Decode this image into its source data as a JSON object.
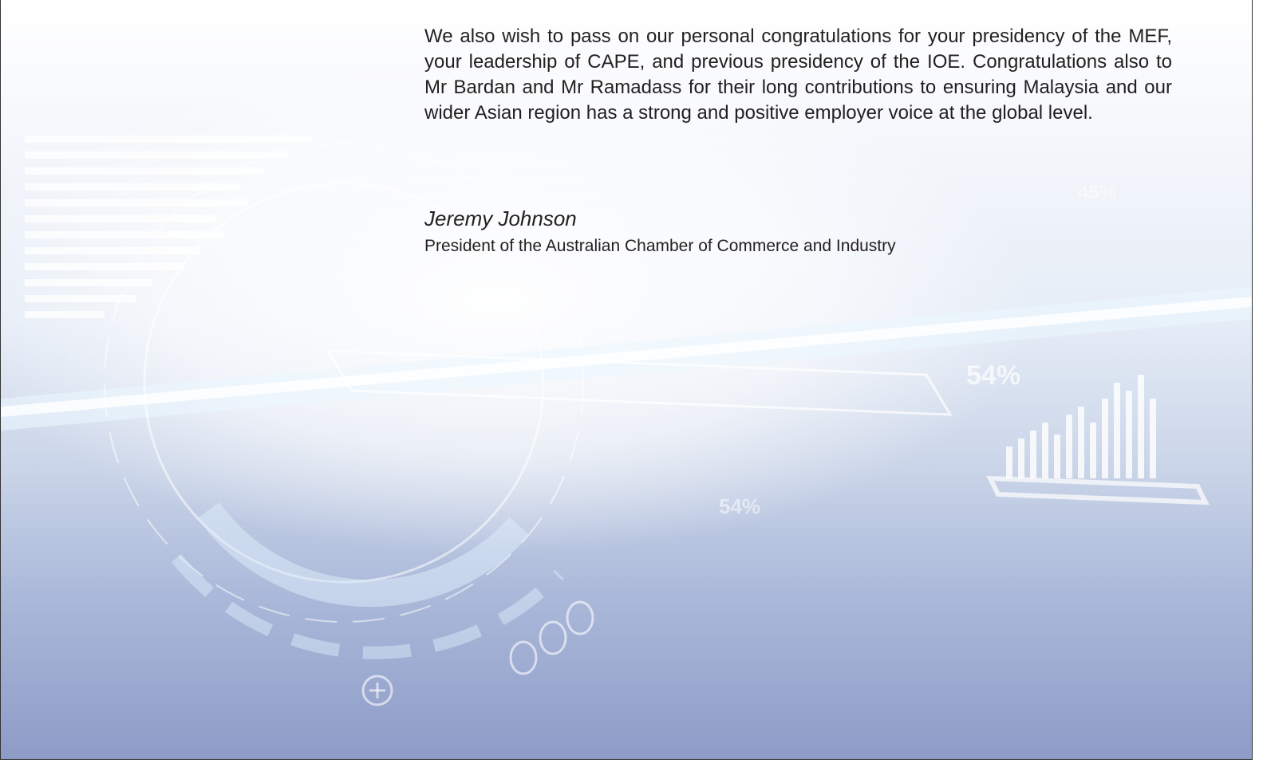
{
  "letter": {
    "paragraph": "We also wish to pass on our personal congratulations for your presidency of the MEF, your leadership of CAPE, and previous presidency of the IOE. Congratulations also to Mr Bardan and Mr Ramadass for their long contributions to ensuring Malaysia and our wider Asian region has a strong and positive employer voice at the global level.",
    "signatory_name": "Jeremy Johnson",
    "signatory_title": "President of the Australian Chamber of Commerce and Industry"
  },
  "background": {
    "decor_label_1": "54%",
    "decor_label_2": "54%",
    "decor_label_3": "45%",
    "colors": {
      "top": "#ffffff",
      "bottom": "#8d9cc7",
      "glow": "#e8f4ff"
    }
  }
}
